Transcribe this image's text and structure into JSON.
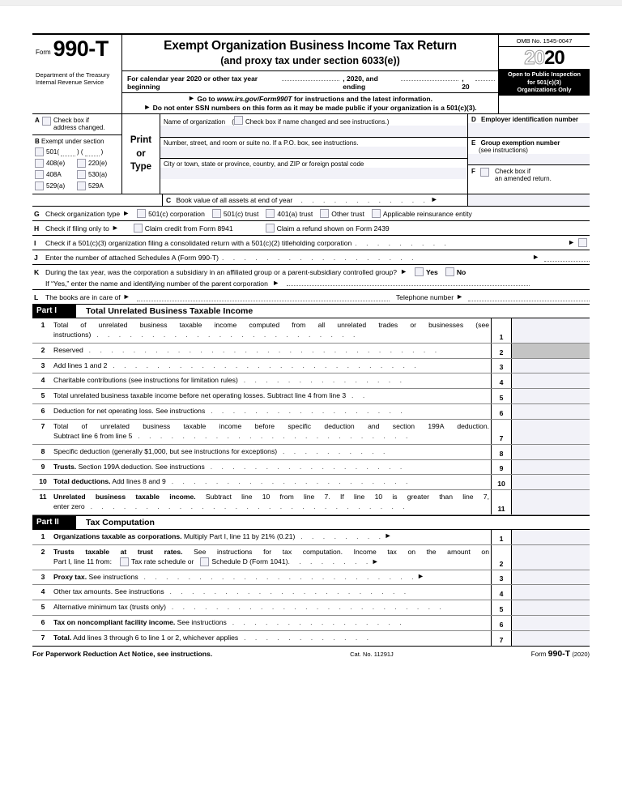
{
  "form": {
    "label_form": "Form",
    "number": "990-T",
    "title_main": "Exempt Organization Business Income Tax Return",
    "title_sub": "(and proxy tax under section 6033(e))",
    "tax_year_line": {
      "prefix": "For calendar year 2020 or other tax year beginning",
      "mid": ", 2020, and ending",
      "suffix": ", 20"
    },
    "goto_line": "Go to www.irs.gov/Form990T for instructions and the latest information.",
    "goto_plain": "Go to ",
    "goto_url": "www.irs.gov/Form990T",
    "goto_tail": " for instructions and the latest information.",
    "ssn_line": "Do not enter SSN numbers on this form as it may be made public if your organization is a 501(c)(3).",
    "department_l1": "Department of the Treasury",
    "department_l2": "Internal Revenue Service",
    "omb": "OMB No. 1545-0047",
    "year_hollow": "20",
    "year_solid": "20",
    "open_public_l1": "Open to Public Inspection",
    "open_public_l2": "for 501(c)(3)",
    "open_public_l3": "Organizations Only"
  },
  "entity": {
    "a": {
      "letter": "A",
      "line1": "Check box if",
      "line2": "address changed."
    },
    "b": {
      "letter": "B",
      "title": "Exempt under section",
      "options": [
        {
          "label": "501(",
          "label2": ") (",
          "label3": ")"
        },
        {
          "label": "408(e)"
        },
        {
          "label": "220(e)"
        },
        {
          "label": "408A"
        },
        {
          "label": "530(a)"
        },
        {
          "label": "529(a)"
        },
        {
          "label": "529A"
        }
      ]
    },
    "print_or_type": [
      "Print",
      "or",
      "Type"
    ],
    "middle_rows": [
      "Name of organization",
      "Number, street, and room or suite no. If a P.O. box, see instructions.",
      "City or town, state or province, country, and ZIP or foreign postal code"
    ],
    "name_checkbox_note_open": "(",
    "name_checkbox_note": "Check box if name changed and see instructions.)",
    "d": {
      "letter": "D",
      "label": "Employer identification number"
    },
    "e": {
      "letter": "E",
      "label": "Group exemption number",
      "sub": "(see instructions)"
    },
    "f": {
      "letter": "F",
      "line1": "Check box if",
      "line2": "an amended return."
    },
    "c": {
      "letter": "C",
      "label": "Book value of all assets at end of year"
    }
  },
  "checklines": {
    "g": {
      "letter": "G",
      "label": "Check organization type",
      "options": [
        "501(c) corporation",
        "501(c) trust",
        "401(a) trust",
        "Other trust",
        "Applicable reinsurance entity"
      ]
    },
    "h": {
      "letter": "H",
      "label": "Check if filing only to",
      "options": [
        "Claim credit from Form 8941",
        "Claim a refund shown on Form 2439"
      ]
    },
    "i": {
      "letter": "I",
      "label": "Check if a 501(c)(3) organization filing a consolidated return with a 501(c)(2) titleholding corporation"
    },
    "j": {
      "letter": "J",
      "label": "Enter the number of attached Schedules A (Form 990-T)"
    },
    "k": {
      "letter": "K",
      "label": "During the tax year, was the corporation a subsidiary in an affiliated group or a parent-subsidiary controlled group?",
      "yes": "Yes",
      "no": "No",
      "line2": "If “Yes,” enter the name and identifying number of the parent corporation"
    },
    "l": {
      "letter": "L",
      "label": "The books are in care of",
      "phone": "Telephone number"
    }
  },
  "part1": {
    "tag": "Part I",
    "title": "Total Unrelated Business Taxable Income",
    "lines": [
      {
        "no": "1",
        "text": "Total of unrelated business taxable income computed from all unrelated trades or businesses (see",
        "text2": "instructions)",
        "box": "1",
        "shaded": false,
        "tall": true
      },
      {
        "no": "2",
        "text": "Reserved",
        "box": "2",
        "shaded": true,
        "tall": false
      },
      {
        "no": "3",
        "text": "Add lines 1 and 2",
        "box": "3",
        "shaded": false,
        "tall": false
      },
      {
        "no": "4",
        "text": "Charitable contributions (see instructions for limitation rules)",
        "box": "4",
        "shaded": false,
        "tall": false
      },
      {
        "no": "5",
        "text": "Total unrelated business taxable income before net operating losses. Subtract line 4 from line 3",
        "box": "5",
        "shaded": false,
        "tall": false
      },
      {
        "no": "6",
        "text": "Deduction for net operating loss. See instructions",
        "box": "6",
        "shaded": false,
        "tall": false
      },
      {
        "no": "7",
        "text": "Total of unrelated business taxable income before specific deduction and section 199A deduction.",
        "text2": "Subtract line 6 from line 5",
        "box": "7",
        "shaded": false,
        "tall": true
      },
      {
        "no": "8",
        "text": "Specific deduction (generally $1,000, but see instructions for exceptions)",
        "box": "8",
        "shaded": false,
        "tall": false
      },
      {
        "no": "9",
        "bold": "Trusts.",
        "text": "Section 199A deduction. See instructions",
        "box": "9",
        "shaded": false,
        "tall": false
      },
      {
        "no": "10",
        "bold": "Total deductions.",
        "text": "Add lines 8 and 9",
        "box": "10",
        "shaded": false,
        "tall": false
      },
      {
        "no": "11",
        "bold": "Unrelated business taxable income.",
        "text": "Subtract line 10 from line 7. If line 10 is greater than line 7,",
        "text2": "enter zero",
        "box": "11",
        "shaded": false,
        "tall": true
      }
    ]
  },
  "part2": {
    "tag": "Part II",
    "title": "Tax Computation",
    "lines": [
      {
        "no": "1",
        "bold": "Organizations taxable as corporations.",
        "text": "Multiply Part I, line 11 by 21% (0.21)",
        "box": "1",
        "arrow": true,
        "tall": false
      },
      {
        "no": "2",
        "bold": "Trusts taxable at trust rates.",
        "text": "See instructions for tax computation. Income tax on the amount on",
        "text2_pre": "Part I, line 11 from:",
        "opt1": "Tax rate schedule or",
        "opt2": "Schedule D (Form 1041)",
        "box": "2",
        "arrow": true,
        "tall": true
      },
      {
        "no": "3",
        "bold": "Proxy tax.",
        "text": "See instructions",
        "box": "3",
        "arrow": true,
        "tall": false
      },
      {
        "no": "4",
        "text": "Other tax amounts. See instructions",
        "box": "4",
        "arrow": false,
        "tall": false
      },
      {
        "no": "5",
        "text": "Alternative minimum tax (trusts only)",
        "box": "5",
        "arrow": false,
        "tall": false
      },
      {
        "no": "6",
        "bold": "Tax on noncompliant facility income.",
        "text": "See instructions",
        "box": "6",
        "arrow": false,
        "tall": false
      },
      {
        "no": "7",
        "bold": "Total.",
        "text": "Add lines 3 through 6 to line 1 or 2, whichever applies",
        "box": "7",
        "arrow": false,
        "tall": false
      }
    ]
  },
  "footer": {
    "left": "For Paperwork Reduction Act Notice, see instructions.",
    "center": "Cat. No. 11291J",
    "right_label": "Form",
    "right_number": "990-T",
    "right_year": "(2020)"
  },
  "colors": {
    "field_fill": "#f2f2f8",
    "shaded_box": "#c4c4c4",
    "rule": "#000000"
  }
}
